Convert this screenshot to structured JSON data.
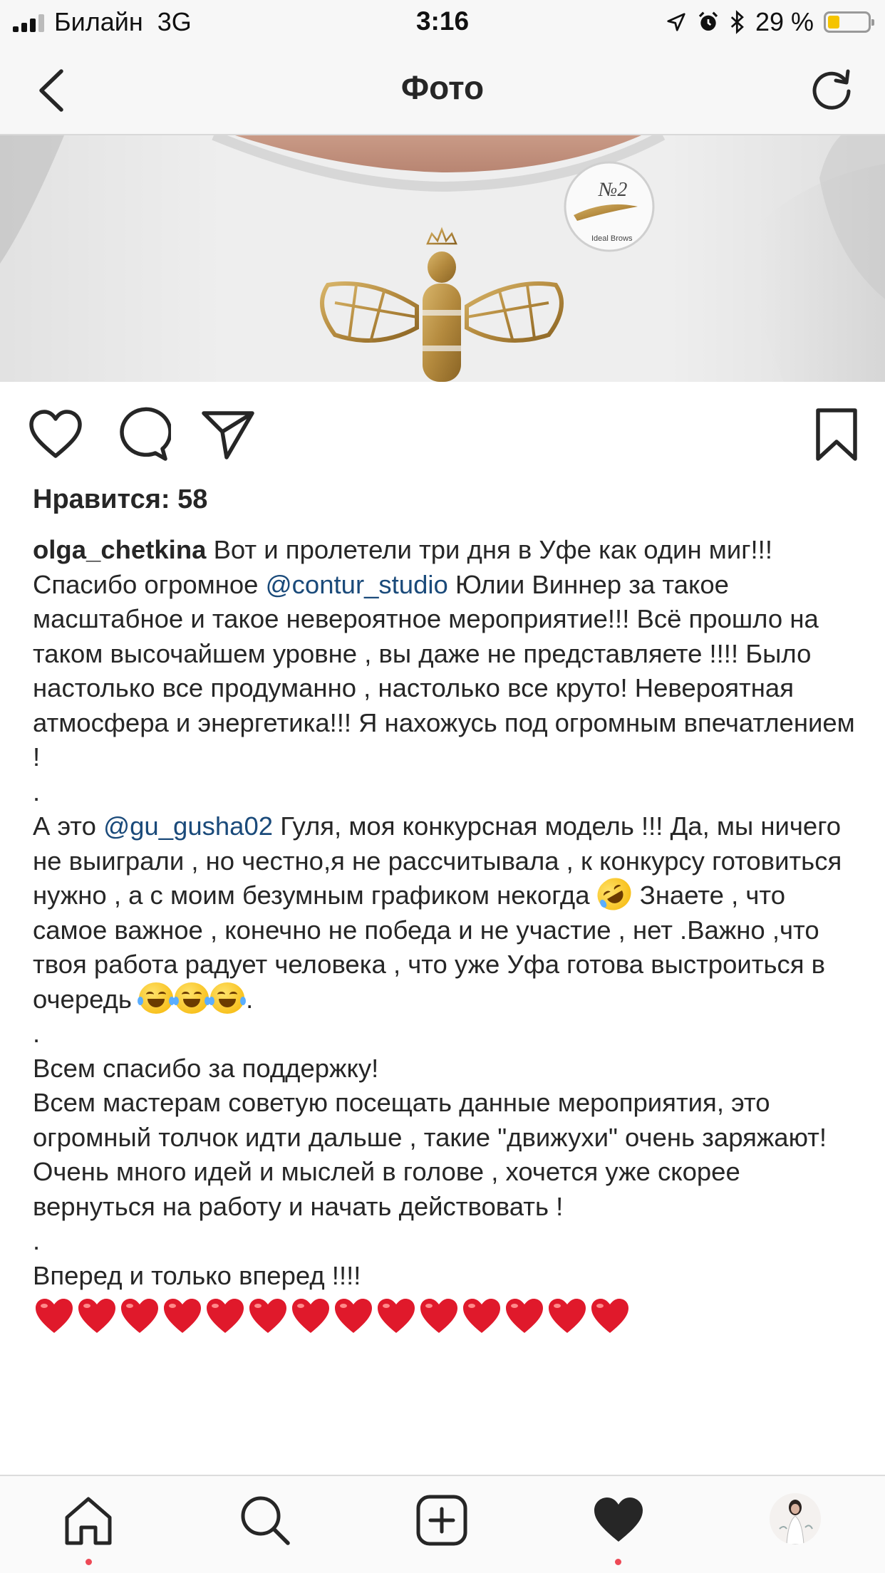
{
  "status_bar": {
    "carrier": "Билайн",
    "network": "3G",
    "time": "3:16",
    "battery_text": "29 %",
    "battery_level": 0.29
  },
  "nav": {
    "title": "Фото"
  },
  "post": {
    "likes": "Нравится: 58",
    "username": "olga_chetkina",
    "caption": {
      "p1": "Вот и пролетели три дня в Уфе как один миг!!!",
      "p2_before": "Спасибо огромное ",
      "p2_mention": "@contur_studio",
      "p2_after": " Юлии Виннер за такое масштабное и такое невероятное мероприятие!!! Всё прошло на таком высочайшем уровне , вы даже не представляете !!!! Было настолько все продуманно , настолько все круто! Невероятная атмосфера и энергетика!!! Я нахожусь под огромным впечатлением !",
      "dot1": ".",
      "p3_before": "А это ",
      "p3_mention": "@gu_gusha02",
      "p3_mid": " Гуля, моя конкурсная модель !!! Да, мы ничего не выиграли , но честно,я не рассчитывала , к конкурсу готовиться нужно , а с моим безумным графиком некогда ",
      "p3_after": " Знаете , что самое важное , конечно не победа и не участие , нет .Важно ,что твоя работа радует человека , что уже Уфа готова выстроиться в очередь ",
      "p3_end": ".",
      "dot2": ".",
      "p4": "Всем спасибо за поддержку!",
      "p5": "Всем мастерам советую посещать данные мероприятия,  это огромный толчок идти дальше , такие \"движухи\" очень заряжают!",
      "p6": "Очень много идей и мыслей в голове , хочется уже скорее вернуться на работу и начать действовать !",
      "dot3": ".",
      "p7": "Вперед и только вперед !!!!",
      "hearts_count": 14
    }
  },
  "icons": {
    "back": "chevron-left-icon",
    "refresh": "refresh-icon",
    "like": "heart-outline-icon",
    "comment": "comment-icon",
    "share": "paper-plane-icon",
    "save": "bookmark-icon"
  },
  "tabs": [
    "home",
    "search",
    "new-post",
    "activity",
    "profile"
  ],
  "colors": {
    "mention": "#1a4a7a",
    "notification_dot": "#ed4956",
    "battery": "#f5c400"
  }
}
